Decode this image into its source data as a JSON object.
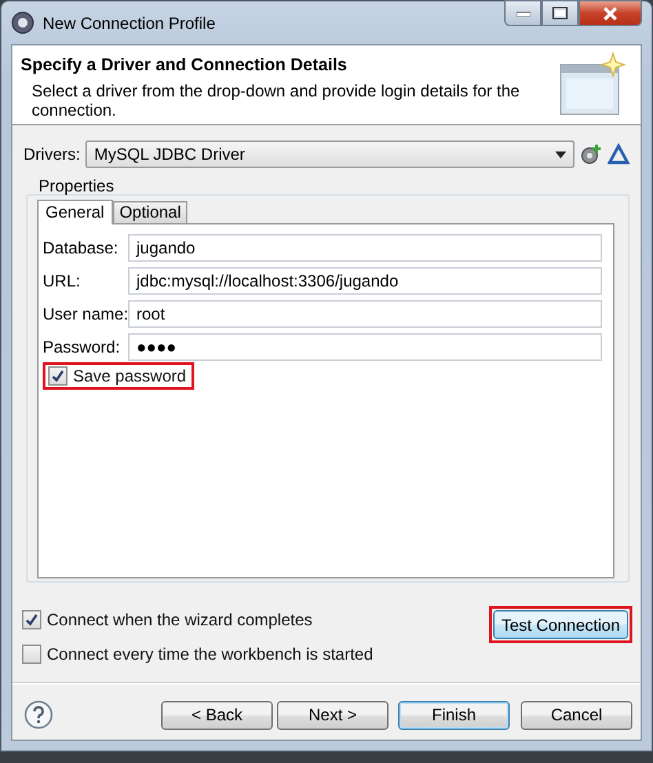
{
  "window": {
    "title": "New Connection Profile"
  },
  "header": {
    "title": "Specify a Driver and Connection Details",
    "description": "Select a driver from the drop-down and provide login details for the connection."
  },
  "drivers": {
    "label": "Drivers:",
    "value": "MySQL JDBC Driver"
  },
  "properties": {
    "title": "Properties",
    "tabs": [
      {
        "label": "General",
        "selected": true
      },
      {
        "label": "Optional",
        "selected": false
      }
    ],
    "fields": [
      {
        "label": "Database:",
        "value": "jugando"
      },
      {
        "label": "URL:",
        "value": "jdbc:mysql://localhost:3306/jugando"
      },
      {
        "label": "User name:",
        "value": "root"
      },
      {
        "label": "Password:",
        "value": "●●●●"
      }
    ],
    "save_password": {
      "label": "Save password",
      "checked": true,
      "highlighted": true
    }
  },
  "options": [
    {
      "label": "Connect when the wizard completes",
      "checked": true
    },
    {
      "label": "Connect every time the workbench is started",
      "checked": false
    }
  ],
  "test_button": {
    "label": "Test Connection",
    "highlighted": true
  },
  "buttons": [
    {
      "label": "< Back",
      "default": false
    },
    {
      "label": "Next >",
      "default": false
    },
    {
      "label": "Finish",
      "default": true
    },
    {
      "label": "Cancel",
      "default": false
    }
  ]
}
